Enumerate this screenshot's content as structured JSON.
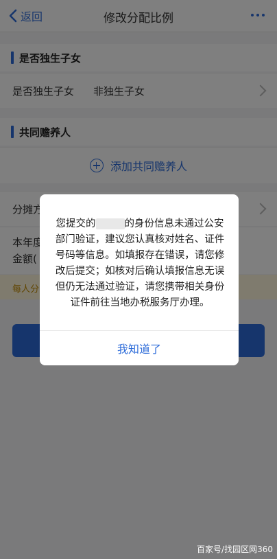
{
  "header": {
    "back_label": "返回",
    "title": "修改分配比例"
  },
  "section1": {
    "title": "是否独生子女",
    "row_label": "是否独生子女",
    "row_value": "非独生子女"
  },
  "section2": {
    "title": "共同赡养人",
    "add_label": "添加共同赡养人"
  },
  "rows": {
    "share_label": "分摊方式",
    "amount_label_1": "本年度",
    "amount_label_2": "金额(",
    "notice": "每人分"
  },
  "dialog": {
    "msg_prefix": "您提交的",
    "msg_body": "的身份信息未通过公安部门验证，建议您认真核对姓名、证件号码等信息。如填报存在错误，请您修改后提交；如核对后确认填报信息无误但仍无法通过验证，请您携带相关身份证件前往当地办税服务厅办理。",
    "confirm_label": "我知道了"
  },
  "watermark": "百家号/找园区网360",
  "colors": {
    "accent": "#2c6bd9",
    "notice_bg": "#fff6dc",
    "notice_text": "#c08a00"
  }
}
